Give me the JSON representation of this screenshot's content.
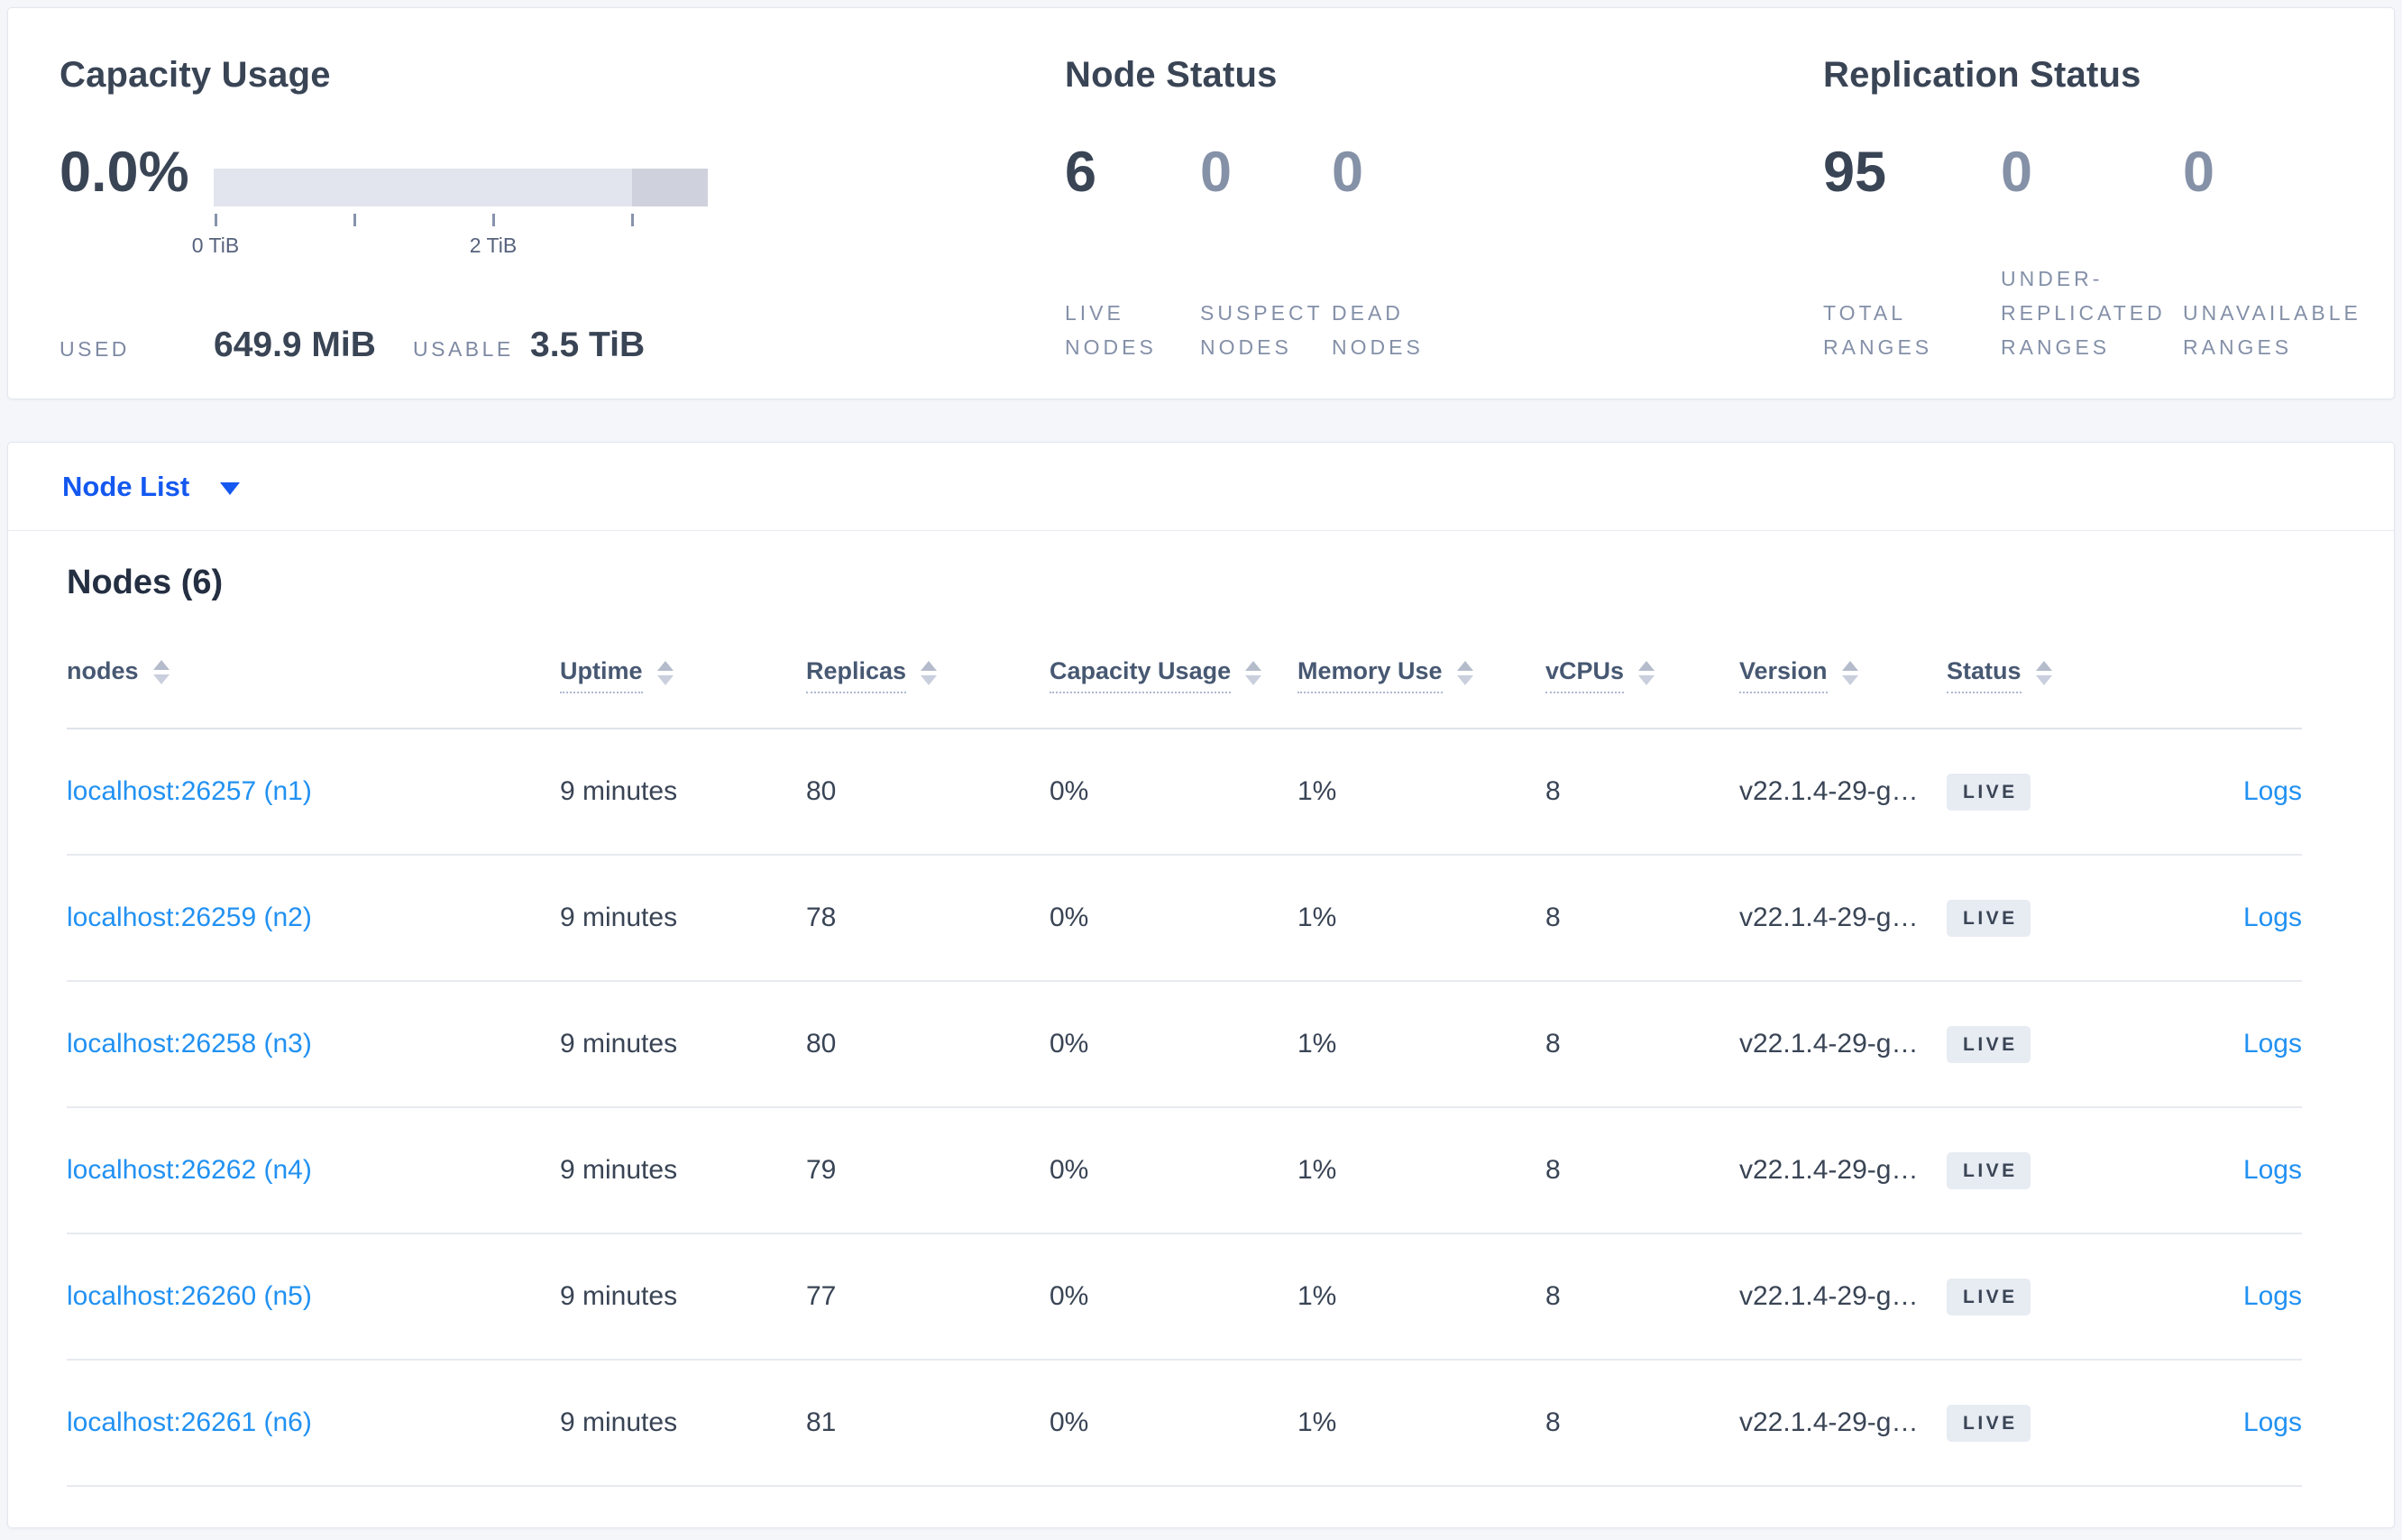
{
  "colors": {
    "link_blue": "#2191f2",
    "selector_blue": "#1458f0",
    "bar_track": "#e2e5ee",
    "bar_reserved": "#cfd2dc",
    "badge_bg": "#e7ebf2",
    "text_dark": "#394455",
    "text_muted": "#8591a7"
  },
  "summary": {
    "capacity": {
      "title": "Capacity Usage",
      "percent": "0.0%",
      "tick_label_0": "0 TiB",
      "tick_label_2": "2 TiB",
      "used_label": "USED",
      "used_value": "649.9 MiB",
      "usable_label": "USABLE",
      "usable_value": "3.5 TiB"
    },
    "node_status": {
      "title": "Node Status",
      "metrics": [
        {
          "value": "6",
          "label": "LIVE NODES"
        },
        {
          "value": "0",
          "label": "SUSPECT NODES"
        },
        {
          "value": "0",
          "label": "DEAD NODES"
        }
      ]
    },
    "replication": {
      "title": "Replication Status",
      "metrics": [
        {
          "value": "95",
          "label": "TOTAL RANGES"
        },
        {
          "value": "0",
          "label": "UNDER-REPLICATED RANGES"
        },
        {
          "value": "0",
          "label": "UNAVAILABLE RANGES"
        }
      ]
    }
  },
  "view_selector": {
    "label": "Node List"
  },
  "nodes_section": {
    "heading": "Nodes (6)",
    "columns": [
      {
        "label": "nodes"
      },
      {
        "label": "Uptime"
      },
      {
        "label": "Replicas"
      },
      {
        "label": "Capacity Usage"
      },
      {
        "label": "Memory Use"
      },
      {
        "label": "vCPUs"
      },
      {
        "label": "Version"
      },
      {
        "label": "Status"
      }
    ],
    "rows": [
      {
        "node": "localhost:26257 (n1)",
        "uptime": "9 minutes",
        "replicas": "80",
        "capacity": "0%",
        "memory": "1%",
        "vcpus": "8",
        "version": "v22.1.4-29-g…",
        "status": "LIVE",
        "logs": "Logs"
      },
      {
        "node": "localhost:26259 (n2)",
        "uptime": "9 minutes",
        "replicas": "78",
        "capacity": "0%",
        "memory": "1%",
        "vcpus": "8",
        "version": "v22.1.4-29-g…",
        "status": "LIVE",
        "logs": "Logs"
      },
      {
        "node": "localhost:26258 (n3)",
        "uptime": "9 minutes",
        "replicas": "80",
        "capacity": "0%",
        "memory": "1%",
        "vcpus": "8",
        "version": "v22.1.4-29-g…",
        "status": "LIVE",
        "logs": "Logs"
      },
      {
        "node": "localhost:26262 (n4)",
        "uptime": "9 minutes",
        "replicas": "79",
        "capacity": "0%",
        "memory": "1%",
        "vcpus": "8",
        "version": "v22.1.4-29-g…",
        "status": "LIVE",
        "logs": "Logs"
      },
      {
        "node": "localhost:26260 (n5)",
        "uptime": "9 minutes",
        "replicas": "77",
        "capacity": "0%",
        "memory": "1%",
        "vcpus": "8",
        "version": "v22.1.4-29-g…",
        "status": "LIVE",
        "logs": "Logs"
      },
      {
        "node": "localhost:26261 (n6)",
        "uptime": "9 minutes",
        "replicas": "81",
        "capacity": "0%",
        "memory": "1%",
        "vcpus": "8",
        "version": "v22.1.4-29-g…",
        "status": "LIVE",
        "logs": "Logs"
      }
    ]
  }
}
